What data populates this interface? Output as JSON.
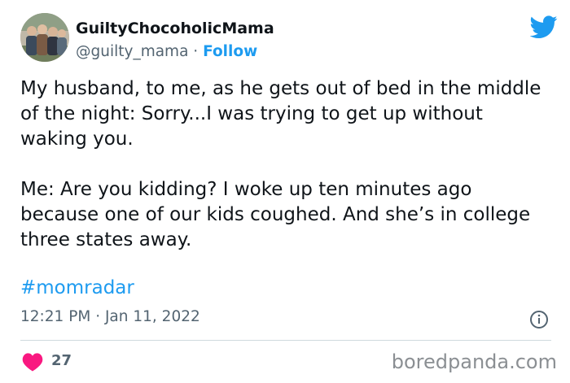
{
  "author": {
    "name": "GuiltyChocoholicMama",
    "handle": "@guilty_mama",
    "separator": " · ",
    "follow_label": "Follow"
  },
  "tweet": {
    "paragraphs": [
      "My husband, to me, as he gets out of bed in the middle of the night: Sorry...I was trying to get up without waking you.",
      "Me: Are you kidding? I woke up ten minutes ago because one of our kids coughed. And she’s in college three states away."
    ],
    "hashtag": "#momradar",
    "time": "12:21 PM",
    "separator": " · ",
    "date": "Jan 11, 2022"
  },
  "engagement": {
    "like_count": "27"
  },
  "watermark": "boredpanda.com",
  "icons": {
    "brand": "twitter-bird-icon",
    "info": "info-icon",
    "like": "heart-icon"
  },
  "colors": {
    "accent": "#1d9bf0",
    "like": "#f91880",
    "secondary_text": "#536471",
    "primary_text": "#0f1419",
    "divider": "#cfd9de"
  }
}
